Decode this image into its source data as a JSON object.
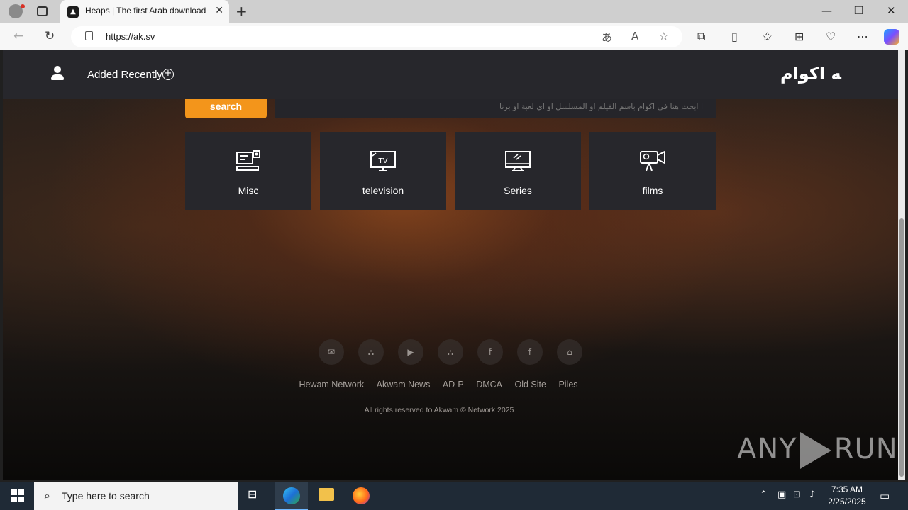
{
  "browser": {
    "tab_title": "Heaps | The first Arab download",
    "url": "https://ak.sv"
  },
  "header": {
    "recent_label": "Added Recently",
    "logo_text": "ﻪ اﻛﻮام"
  },
  "search": {
    "button_label": "search",
    "placeholder": "ا ابحث هنا في اكوام باسم الفيلم او المسلسل او اي لعبة او برنا"
  },
  "categories": [
    {
      "label": "Misc",
      "icon": "misc-icon"
    },
    {
      "label": "television",
      "icon": "tv-icon"
    },
    {
      "label": "Series",
      "icon": "series-icon"
    },
    {
      "label": "films",
      "icon": "films-icon"
    }
  ],
  "social_icons": [
    "mail-icon",
    "akwam-icon",
    "youtube-icon",
    "akwam-icon",
    "facebook-icon",
    "facebook-icon",
    "home-icon"
  ],
  "footer": {
    "links": [
      "Hewam Network",
      "Akwam News",
      "AD-P",
      "DMCA",
      "Old Site",
      "Piles"
    ],
    "copyright": "All rights reserved to Akwam © Network 2025"
  },
  "watermark": {
    "left": "ANY",
    "right": "RUN"
  },
  "taskbar": {
    "search_placeholder": "Type here to search",
    "time": "7:35 AM",
    "date": "2/25/2025"
  },
  "colors": {
    "accent": "#f3951b",
    "header_bg": "#27272c"
  }
}
